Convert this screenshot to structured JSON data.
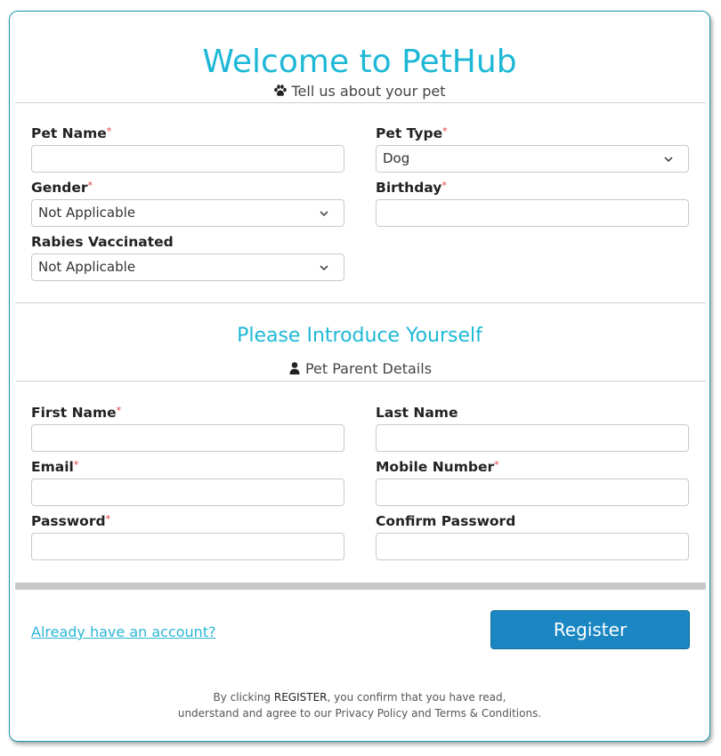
{
  "header": {
    "title": "Welcome to PetHub",
    "pet_section_subtitle": "Tell us about your pet"
  },
  "pet_form": {
    "pet_name": {
      "label": "Pet Name",
      "required": "*",
      "value": "",
      "placeholder": ""
    },
    "pet_type": {
      "label": "Pet Type",
      "required": "*",
      "selected": "Dog"
    },
    "gender": {
      "label": "Gender",
      "required": "*",
      "selected": "Not Applicable"
    },
    "birthday": {
      "label": "Birthday",
      "required": "*",
      "value": "",
      "placeholder": ""
    },
    "rabies": {
      "label": "Rabies Vaccinated",
      "selected": "Not Applicable"
    }
  },
  "parent_section": {
    "title": "Please Introduce Yourself",
    "subtitle": "Pet Parent Details"
  },
  "parent_form": {
    "first_name": {
      "label": "First Name",
      "required": "*",
      "value": ""
    },
    "last_name": {
      "label": "Last Name",
      "value": ""
    },
    "email": {
      "label": "Email",
      "required": "*",
      "value": ""
    },
    "mobile": {
      "label": "Mobile Number",
      "required": "*",
      "value": ""
    },
    "password": {
      "label": "Password",
      "required": "*",
      "value": ""
    },
    "confirm_password": {
      "label": "Confirm Password",
      "value": ""
    }
  },
  "footer": {
    "login_link": "Already have an account?",
    "register_label": "Register",
    "terms_prefix": "By clicking ",
    "terms_keyword": "REGISTER",
    "terms_line1_suffix": ", you confirm that you have read,",
    "terms_line2": "understand and agree to our Privacy Policy and Terms & Conditions."
  },
  "icons": {
    "pet_section": "paw-icon",
    "parent_section": "user-icon",
    "dropdown": "chevron-down-icon"
  },
  "colors": {
    "accent": "#1eb8d6",
    "button": "#1a86c2",
    "required": "#e03a3a"
  }
}
